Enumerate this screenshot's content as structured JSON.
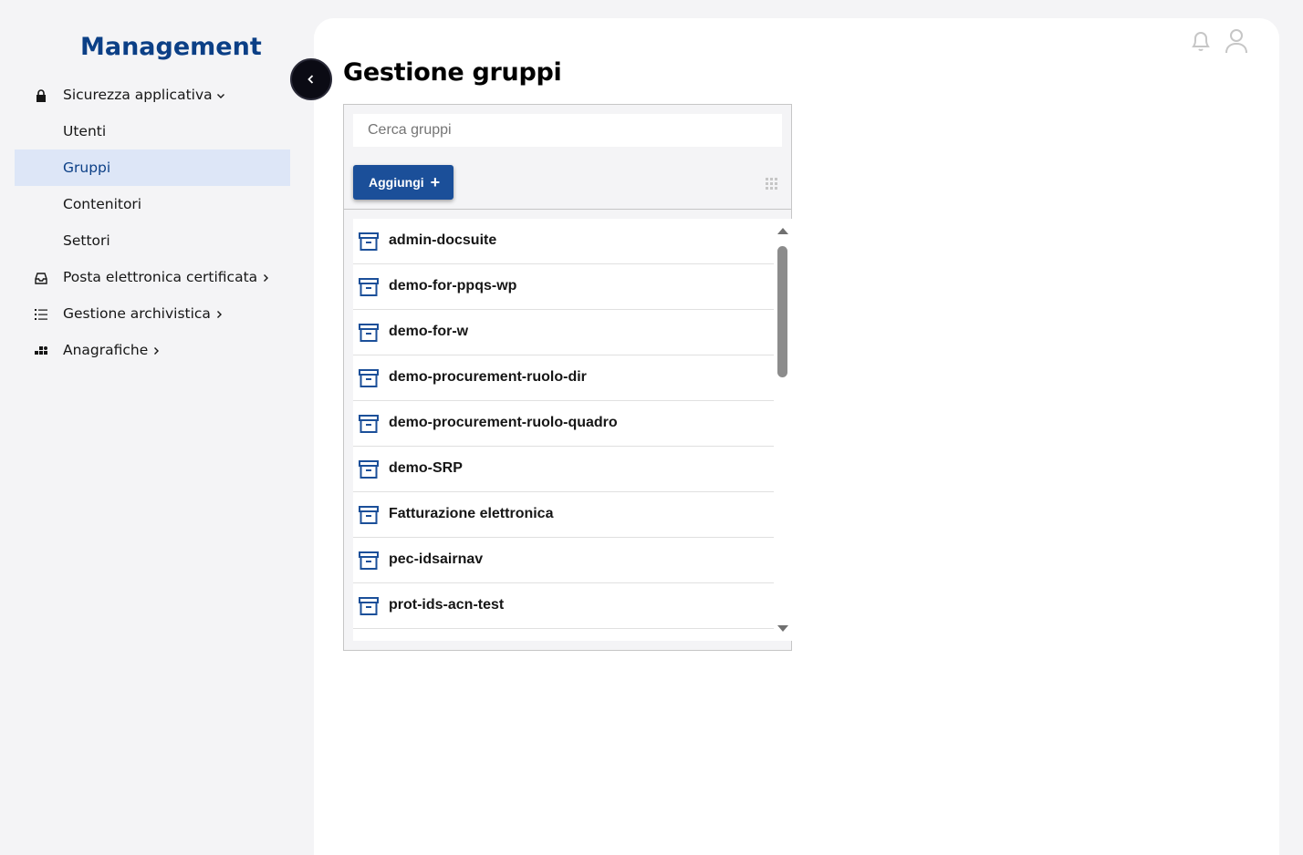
{
  "brand": {
    "title": "Management"
  },
  "sidebar": {
    "items": [
      {
        "label": "Sicurezza applicativa",
        "icon": "lock-icon",
        "expanded": true
      },
      {
        "label": "Utenti"
      },
      {
        "label": "Gruppi",
        "active": true
      },
      {
        "label": "Contenitori"
      },
      {
        "label": "Settori"
      },
      {
        "label": "Posta elettronica certificata",
        "icon": "inbox-icon"
      },
      {
        "label": "Gestione archivistica",
        "icon": "list-icon"
      },
      {
        "label": "Anagrafiche",
        "icon": "apps-icon"
      }
    ]
  },
  "header": {
    "icons": [
      "bell-icon",
      "user-icon"
    ]
  },
  "main": {
    "title": "Gestione gruppi",
    "search": {
      "placeholder": "Cerca gruppi",
      "value": ""
    },
    "add_label": "Aggiungi",
    "groups": [
      "admin-docsuite",
      "demo-for-ppqs-wp",
      "demo-for-w",
      "demo-procurement-ruolo-dir",
      "demo-procurement-ruolo-quadro",
      "demo-SRP",
      "Fatturazione elettronica",
      "pec-idsairnav",
      "prot-ids-acn-test"
    ]
  },
  "colors": {
    "brand": "#0b3f86",
    "accent": "#1b4f99",
    "active_bg": "#dde6f7",
    "background": "#f4f4f6"
  }
}
